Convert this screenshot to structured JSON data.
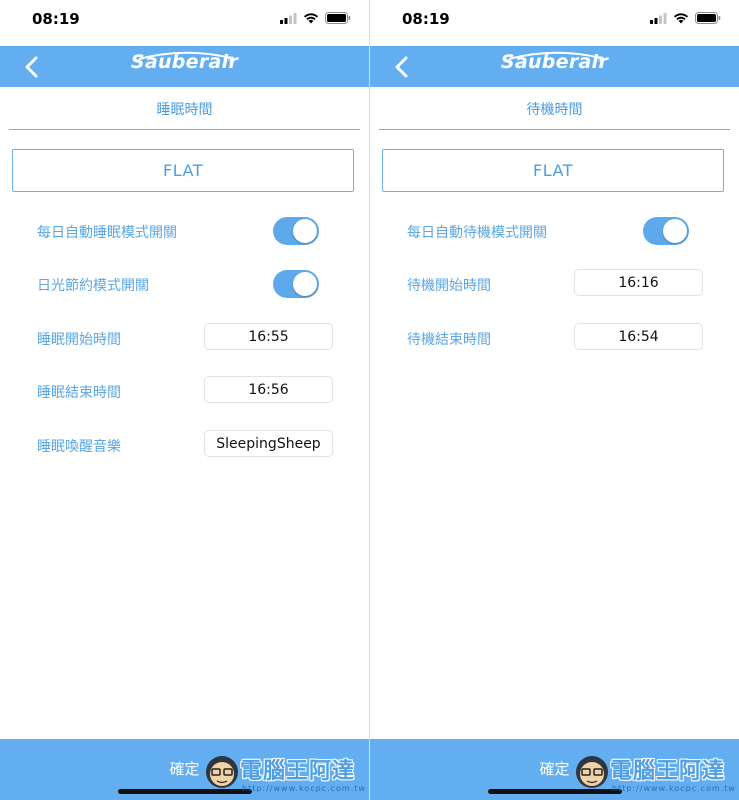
{
  "status_bar": {
    "time": "08:19"
  },
  "app": {
    "brand": "Sauberair",
    "reg_mark": "®"
  },
  "left_screen": {
    "title": "睡眠時間",
    "mode": "FLAT",
    "settings": [
      {
        "label": "每日自動睡眠模式開關",
        "type": "toggle",
        "on": true
      },
      {
        "label": "日光節約模式開關",
        "type": "toggle",
        "on": true
      },
      {
        "label": "睡眠開始時間",
        "type": "value",
        "value": "16:55"
      },
      {
        "label": "睡眠結束時間",
        "type": "value",
        "value": "16:56"
      },
      {
        "label": "睡眠喚醒音樂",
        "type": "value",
        "value": "SleepingSheep"
      }
    ],
    "confirm_label": "確定"
  },
  "right_screen": {
    "title": "待機時間",
    "mode": "FLAT",
    "settings": [
      {
        "label": "每日自動待機模式開關",
        "type": "toggle",
        "on": true
      },
      {
        "label": "待機開始時間",
        "type": "value",
        "value": "16:16"
      },
      {
        "label": "待機結束時間",
        "type": "value",
        "value": "16:54"
      }
    ],
    "confirm_label": "確定"
  },
  "watermark": {
    "text": "電腦王阿達",
    "url": "http://www.kocpc.com.tw"
  },
  "colors": {
    "accent": "#63aef0",
    "text_blue": "#5aa6e6",
    "toggle_on": "#5ea9ec"
  },
  "icons": [
    "back-chevron-icon",
    "cellular-signal-icon",
    "wifi-icon",
    "battery-icon"
  ]
}
